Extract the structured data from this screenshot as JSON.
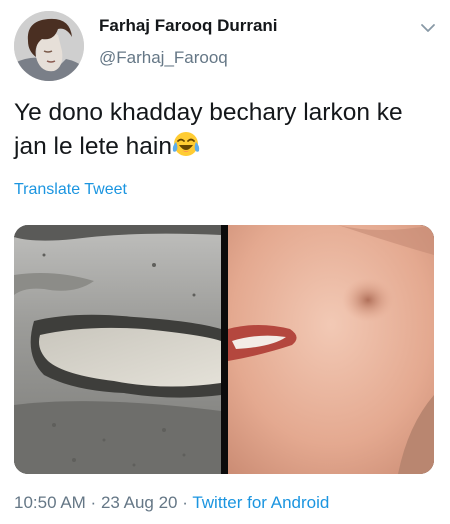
{
  "tweet": {
    "author": {
      "display_name": "Farhaj Farooq Durrani",
      "handle": "@Farhaj_Farooq",
      "avatar_icon": "user-avatar"
    },
    "menu_icon": "chevron-down-icon",
    "text_part1": "Ye dono khadday bechary larkon ke jan le lete hain",
    "emoji": "😂",
    "translate_label": "Translate Tweet",
    "media": {
      "left_image": "pothole-in-road",
      "right_image": "dimple-on-cheek"
    },
    "meta": {
      "time": "10:50 AM",
      "separator": " · ",
      "date": "23 Aug 20",
      "source": "Twitter for Android"
    }
  },
  "colors": {
    "text": "#14171a",
    "secondary": "#657786",
    "link": "#1b95e0"
  }
}
